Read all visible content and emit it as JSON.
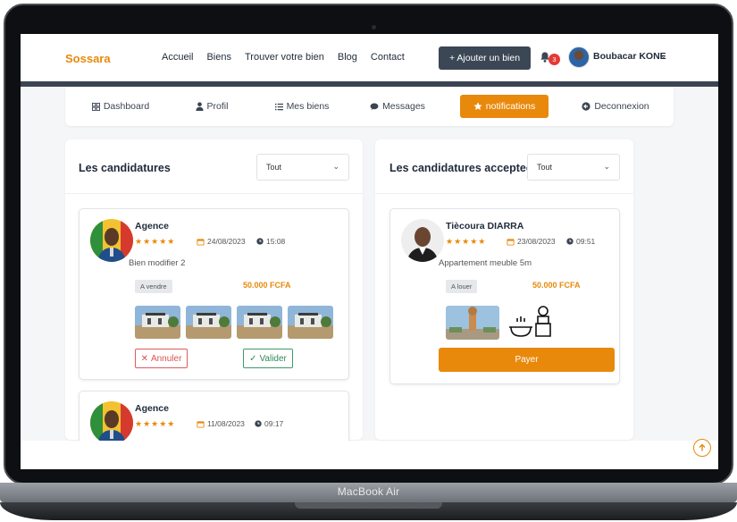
{
  "device": {
    "label": "MacBook Air"
  },
  "navbar": {
    "logo": "Sossara",
    "links": [
      "Accueil",
      "Biens",
      "Trouver votre bien",
      "Blog",
      "Contact"
    ],
    "add_button": "+ Ajouter un bien",
    "notification_count": "3",
    "user_name": "Boubacar KONE"
  },
  "tabs": [
    {
      "label": "Dashboard",
      "icon": "grid-icon"
    },
    {
      "label": "Profil",
      "icon": "user-icon"
    },
    {
      "label": "Mes biens",
      "icon": "list-icon"
    },
    {
      "label": "Messages",
      "icon": "chat-icon"
    },
    {
      "label": "notifications",
      "icon": "star-icon",
      "active": true
    },
    {
      "label": "Deconnexion",
      "icon": "logout-icon"
    }
  ],
  "candidatures": {
    "title": "Les candidatures",
    "filter": "Tout",
    "cards": [
      {
        "name": "Agence",
        "rating": 5,
        "date": "24/08/2023",
        "time": "15:08",
        "description": "Bien modifier 2",
        "status": "A vendre",
        "price": "50.000 FCFA",
        "cancel_label": "Annuler",
        "validate_label": "Valider"
      },
      {
        "name": "Agence",
        "rating": 5,
        "date": "11/08/2023",
        "time": "09:17"
      }
    ]
  },
  "acceptees": {
    "title": "Les candidatures acceptees",
    "filter": "Tout",
    "card": {
      "name": "Tiècoura DIARRA",
      "rating": 5,
      "date": "23/08/2023",
      "time": "09:51",
      "description": "Appartement meuble 5m",
      "status": "A louer",
      "price": "50.000 FCFA",
      "pay_label": "Payer"
    }
  },
  "colors": {
    "accent": "#e8890c",
    "navy": "#3c4756",
    "danger": "#d9534f",
    "success": "#2f8b5c"
  }
}
